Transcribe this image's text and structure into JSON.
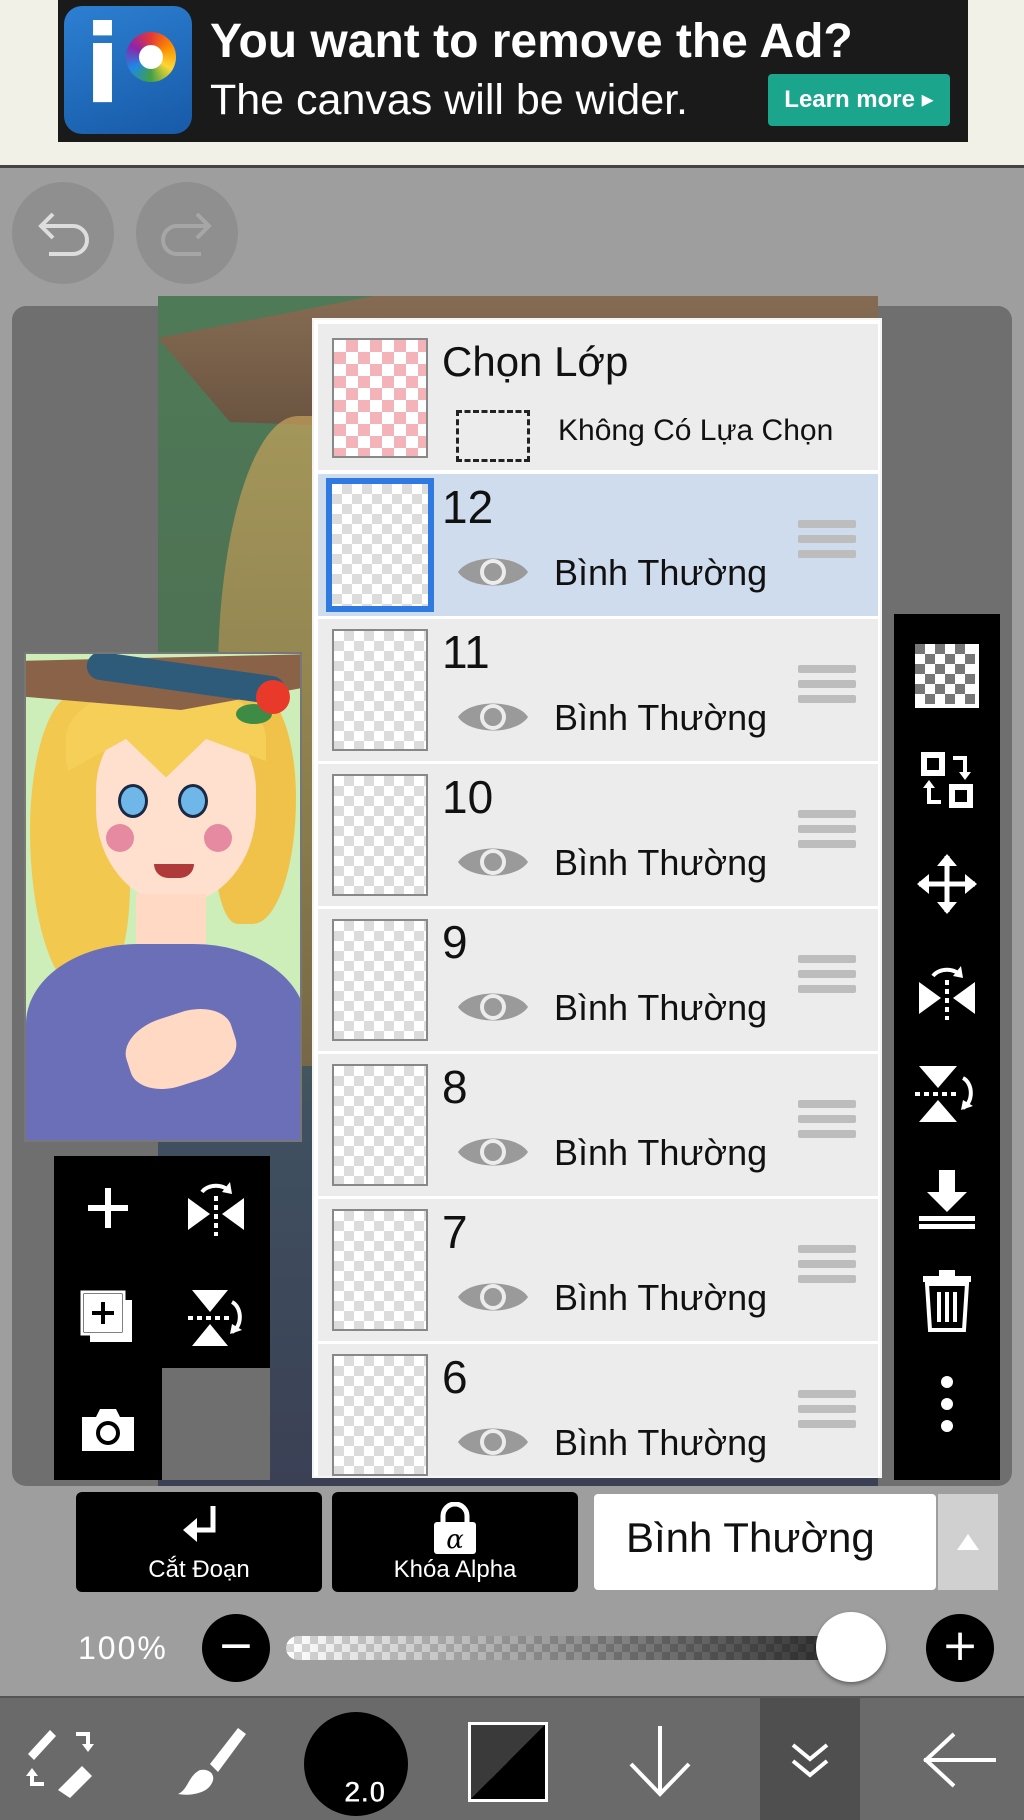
{
  "ad": {
    "title": "You want to remove the Ad?",
    "subtitle": "The canvas will be wider.",
    "button": "Learn more ▸"
  },
  "layer_panel": {
    "header": {
      "title": "Chọn Lớp",
      "selection_status": "Không Có Lựa Chọn"
    },
    "layers": [
      {
        "name": "12",
        "mode": "Bình Thường",
        "selected": true
      },
      {
        "name": "11",
        "mode": "Bình Thường",
        "selected": false
      },
      {
        "name": "10",
        "mode": "Bình Thường",
        "selected": false
      },
      {
        "name": "9",
        "mode": "Bình Thường",
        "selected": false
      },
      {
        "name": "8",
        "mode": "Bình Thường",
        "selected": false
      },
      {
        "name": "7",
        "mode": "Bình Thường",
        "selected": false
      },
      {
        "name": "6",
        "mode": "Bình Thường",
        "selected": false
      }
    ]
  },
  "controls": {
    "clipping_label": "Cắt Đoạn",
    "alpha_lock_label": "Khóa Alpha",
    "alpha_lock_glyph": "α",
    "blend_mode": "Bình Thường",
    "opacity_label": "100%",
    "opacity_value": 1.0,
    "minus": "−",
    "plus": "+"
  },
  "toolbar": {
    "brush_size": "2.0",
    "primary_color": "#000000",
    "secondary_color": "#3a3a3a"
  },
  "icons": {
    "undo": "undo-icon",
    "redo": "redo-icon",
    "right_panel": [
      "transparency-grid-icon",
      "swap-layer-icon",
      "move-icon",
      "flip-horizontal-icon",
      "flip-vertical-icon",
      "merge-down-icon",
      "trash-icon",
      "more-vertical-icon"
    ],
    "left_panel": [
      "add-layer-icon",
      "flip-horizontal-icon",
      "duplicate-layer-icon",
      "flip-vertical-icon",
      "camera-icon"
    ],
    "bottom_bar": [
      "tool-switch-icon",
      "brush-icon",
      "brush-size",
      "color-swatch",
      "arrow-down-icon",
      "double-chevron-down-icon",
      "back-arrow-icon"
    ]
  }
}
